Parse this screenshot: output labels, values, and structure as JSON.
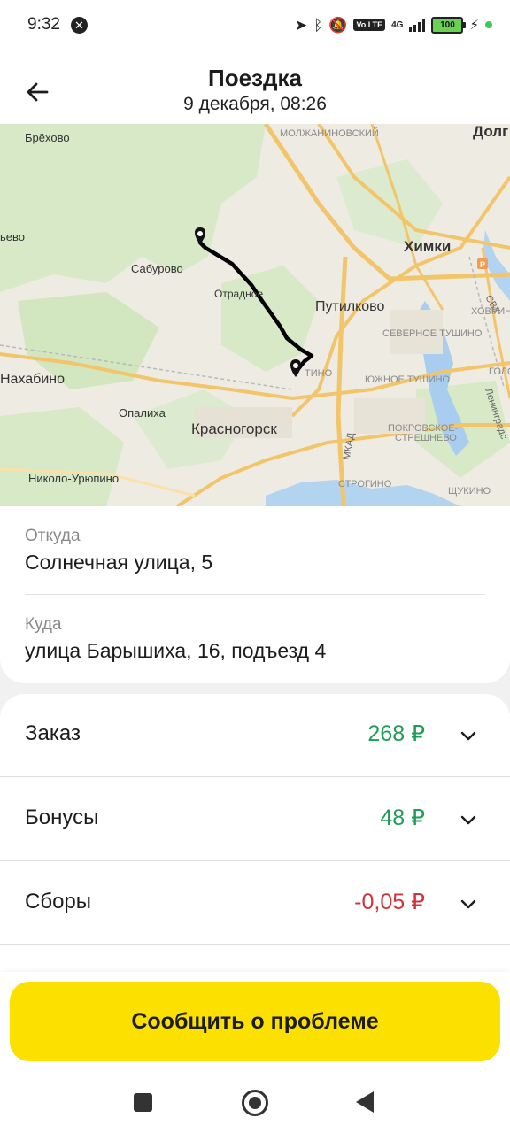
{
  "status_bar": {
    "time": "9:32",
    "network": "4G",
    "lte": "Vo LTE",
    "battery": "100"
  },
  "header": {
    "title": "Поездка",
    "subtitle": "9 декабря, 08:26",
    "back_icon": "arrow-left-icon"
  },
  "map": {
    "labels": {
      "brekhovo": "Брёхово",
      "molzhaninovsky": "МОЛЖАНИНОВСКИЙ",
      "dolg": "Долг",
      "evo": "ьево",
      "khimki": "Химки",
      "saburovo": "Сабурово",
      "otradnoe": "Отрадное",
      "svkh": "СВХ",
      "putilkovo": "Путилково",
      "khovrino": "ХОВРИНО",
      "severnoe_tushino": "СЕВЕРНОЕ ТУШИНО",
      "nakhabino": "Нахабино",
      "tino": "ТИНО",
      "yuzhnoe_tushino": "ЮЖНОЕ ТУШИНО",
      "golo": "ГОЛО",
      "leningrad": "Ленинградс",
      "opalikha": "Опалиха",
      "mkad": "МКАД",
      "pokrovskoe": "ПОКРОВСКОЕ-",
      "streshnevo": "СТРЕШНЕВО",
      "krasnogorsk": "Красногорск",
      "nikolo_uryupino": "Николо-Урюпино",
      "strogino": "СТРОГИНО",
      "shchukino": "ЩУКИНО"
    },
    "route_color": "#000000"
  },
  "addresses": {
    "from_label": "Откуда",
    "from_value": "Солнечная улица, 5",
    "to_label": "Куда",
    "to_value": "улица Барышиха, 16, подъезд 4"
  },
  "details": [
    {
      "label": "Заказ",
      "amount": "268 ₽",
      "color": "#1f9d55"
    },
    {
      "label": "Бонусы",
      "amount": "48 ₽",
      "color": "#1f9d55"
    },
    {
      "label": "Сборы",
      "amount": "-0,05 ₽",
      "color": "#d0343b"
    }
  ],
  "actions": {
    "report_label": "Сообщить о проблеме",
    "accent": "#fce000"
  }
}
